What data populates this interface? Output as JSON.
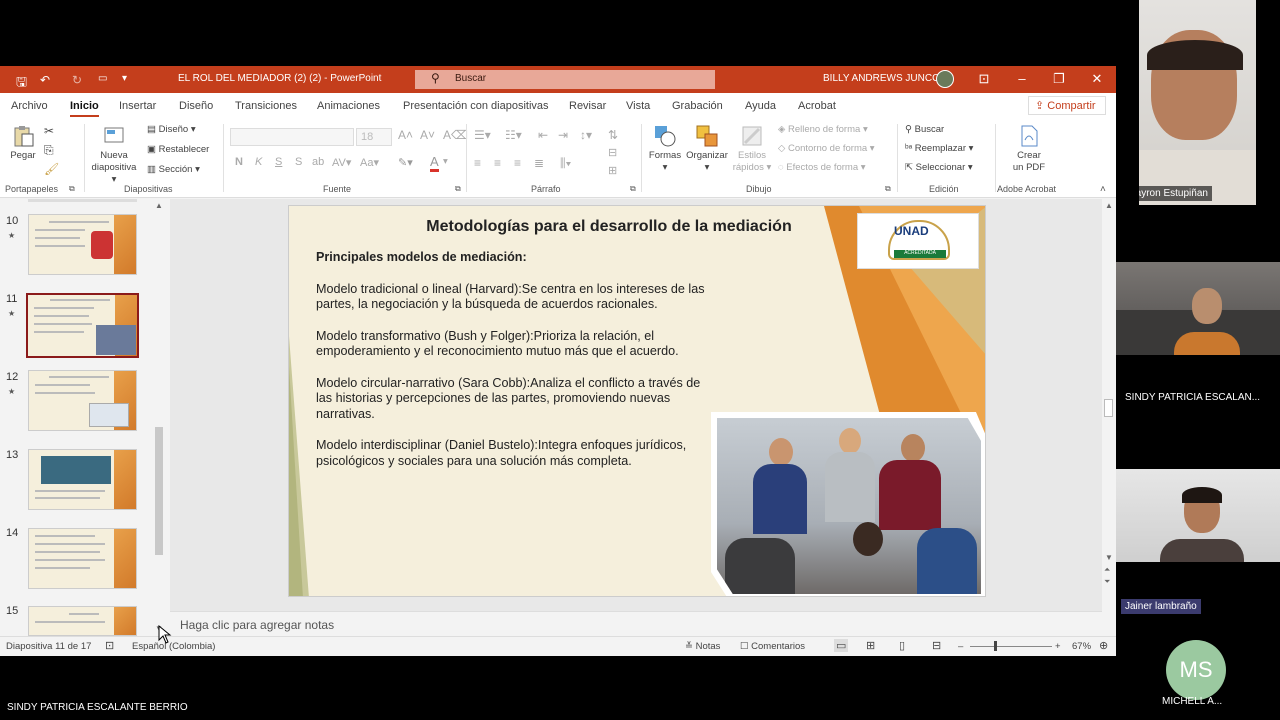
{
  "window": {
    "doc_title": "EL ROL DEL MEDIADOR (2) (2)  -  PowerPoint",
    "search_placeholder": "Buscar",
    "user": "BILLY ANDREWS JUNCO"
  },
  "menu": [
    "Archivo",
    "Inicio",
    "Insertar",
    "Diseño",
    "Transiciones",
    "Animaciones",
    "Presentación con diapositivas",
    "Revisar",
    "Vista",
    "Grabación",
    "Ayuda",
    "Acrobat"
  ],
  "share_label": "Compartir",
  "ribbon": {
    "portapapeles": {
      "label": "Portapapeles",
      "pegar": "Pegar"
    },
    "diapositivas": {
      "label": "Diapositivas",
      "nueva": "Nueva",
      "nueva2": "diapositiva",
      "diseno": "Diseño",
      "restablecer": "Restablecer",
      "seccion": "Sección"
    },
    "fuente": {
      "label": "Fuente",
      "size": "18",
      "bold": "N",
      "italic": "K",
      "underline": "S",
      "strike": "S"
    },
    "parrafo": {
      "label": "Párrafo"
    },
    "dibujo": {
      "label": "Dibujo",
      "formas": "Formas",
      "organizar": "Organizar",
      "estilos": "Estilos",
      "estilos2": "rápidos",
      "relleno": "Relleno de forma",
      "contorno": "Contorno de forma",
      "efectos": "Efectos de forma"
    },
    "edicion": {
      "label": "Edición",
      "buscar": "Buscar",
      "reemplazar": "Reemplazar",
      "seleccionar": "Seleccionar"
    },
    "acrobat": {
      "label": "Adobe Acrobat",
      "crear": "Crear",
      "crear2": "un PDF"
    }
  },
  "thumbs": [
    {
      "num": "10",
      "star": true
    },
    {
      "num": "11",
      "star": true
    },
    {
      "num": "12",
      "star": true
    },
    {
      "num": "13",
      "star": false
    },
    {
      "num": "14",
      "star": false
    },
    {
      "num": "15",
      "star": false
    }
  ],
  "slide": {
    "title": "Metodologías para el desarrollo de la mediación",
    "subtitle": "Principales modelos de mediación:",
    "paragraphs": [
      "Modelo tradicional o lineal (Harvard):Se centra en los intereses de las partes, la negociación y la búsqueda de acuerdos racionales.",
      "Modelo transformativo (Bush y Folger):Prioriza la relación, el empoderamiento y el reconocimiento mutuo más que el acuerdo.",
      "Modelo circular-narrativo (Sara Cobb):Analiza el conflicto a través de las historias y percepciones de las partes, promoviendo nuevas narrativas.",
      "Modelo interdisciplinar (Daniel Bustelo):Integra enfoques jurídicos, psicológicos y sociales para una solución más completa."
    ],
    "logo": "UNAD",
    "logo_sub": "ACREDITADA"
  },
  "notes_placeholder": "Haga clic para agregar notas",
  "status": {
    "slide_info": "Diapositiva 11 de 17",
    "language": "Español (Colombia)",
    "notes": "Notas",
    "comments": "Comentarios",
    "zoom": "67%"
  },
  "participants": [
    {
      "name": "Bayron Estupiñan"
    },
    {
      "name": "SINDY PATRICIA ESCALAN..."
    },
    {
      "name": "Jainer lambraño"
    },
    {
      "name": "MICHELL A...",
      "initials": "MS"
    }
  ],
  "bottom_name": "SINDY PATRICIA ESCALANTE BERRIO",
  "colors": {
    "accent": "#c43e1c",
    "slide_bg": "#f5efdc",
    "orange": "#e08a2e"
  }
}
